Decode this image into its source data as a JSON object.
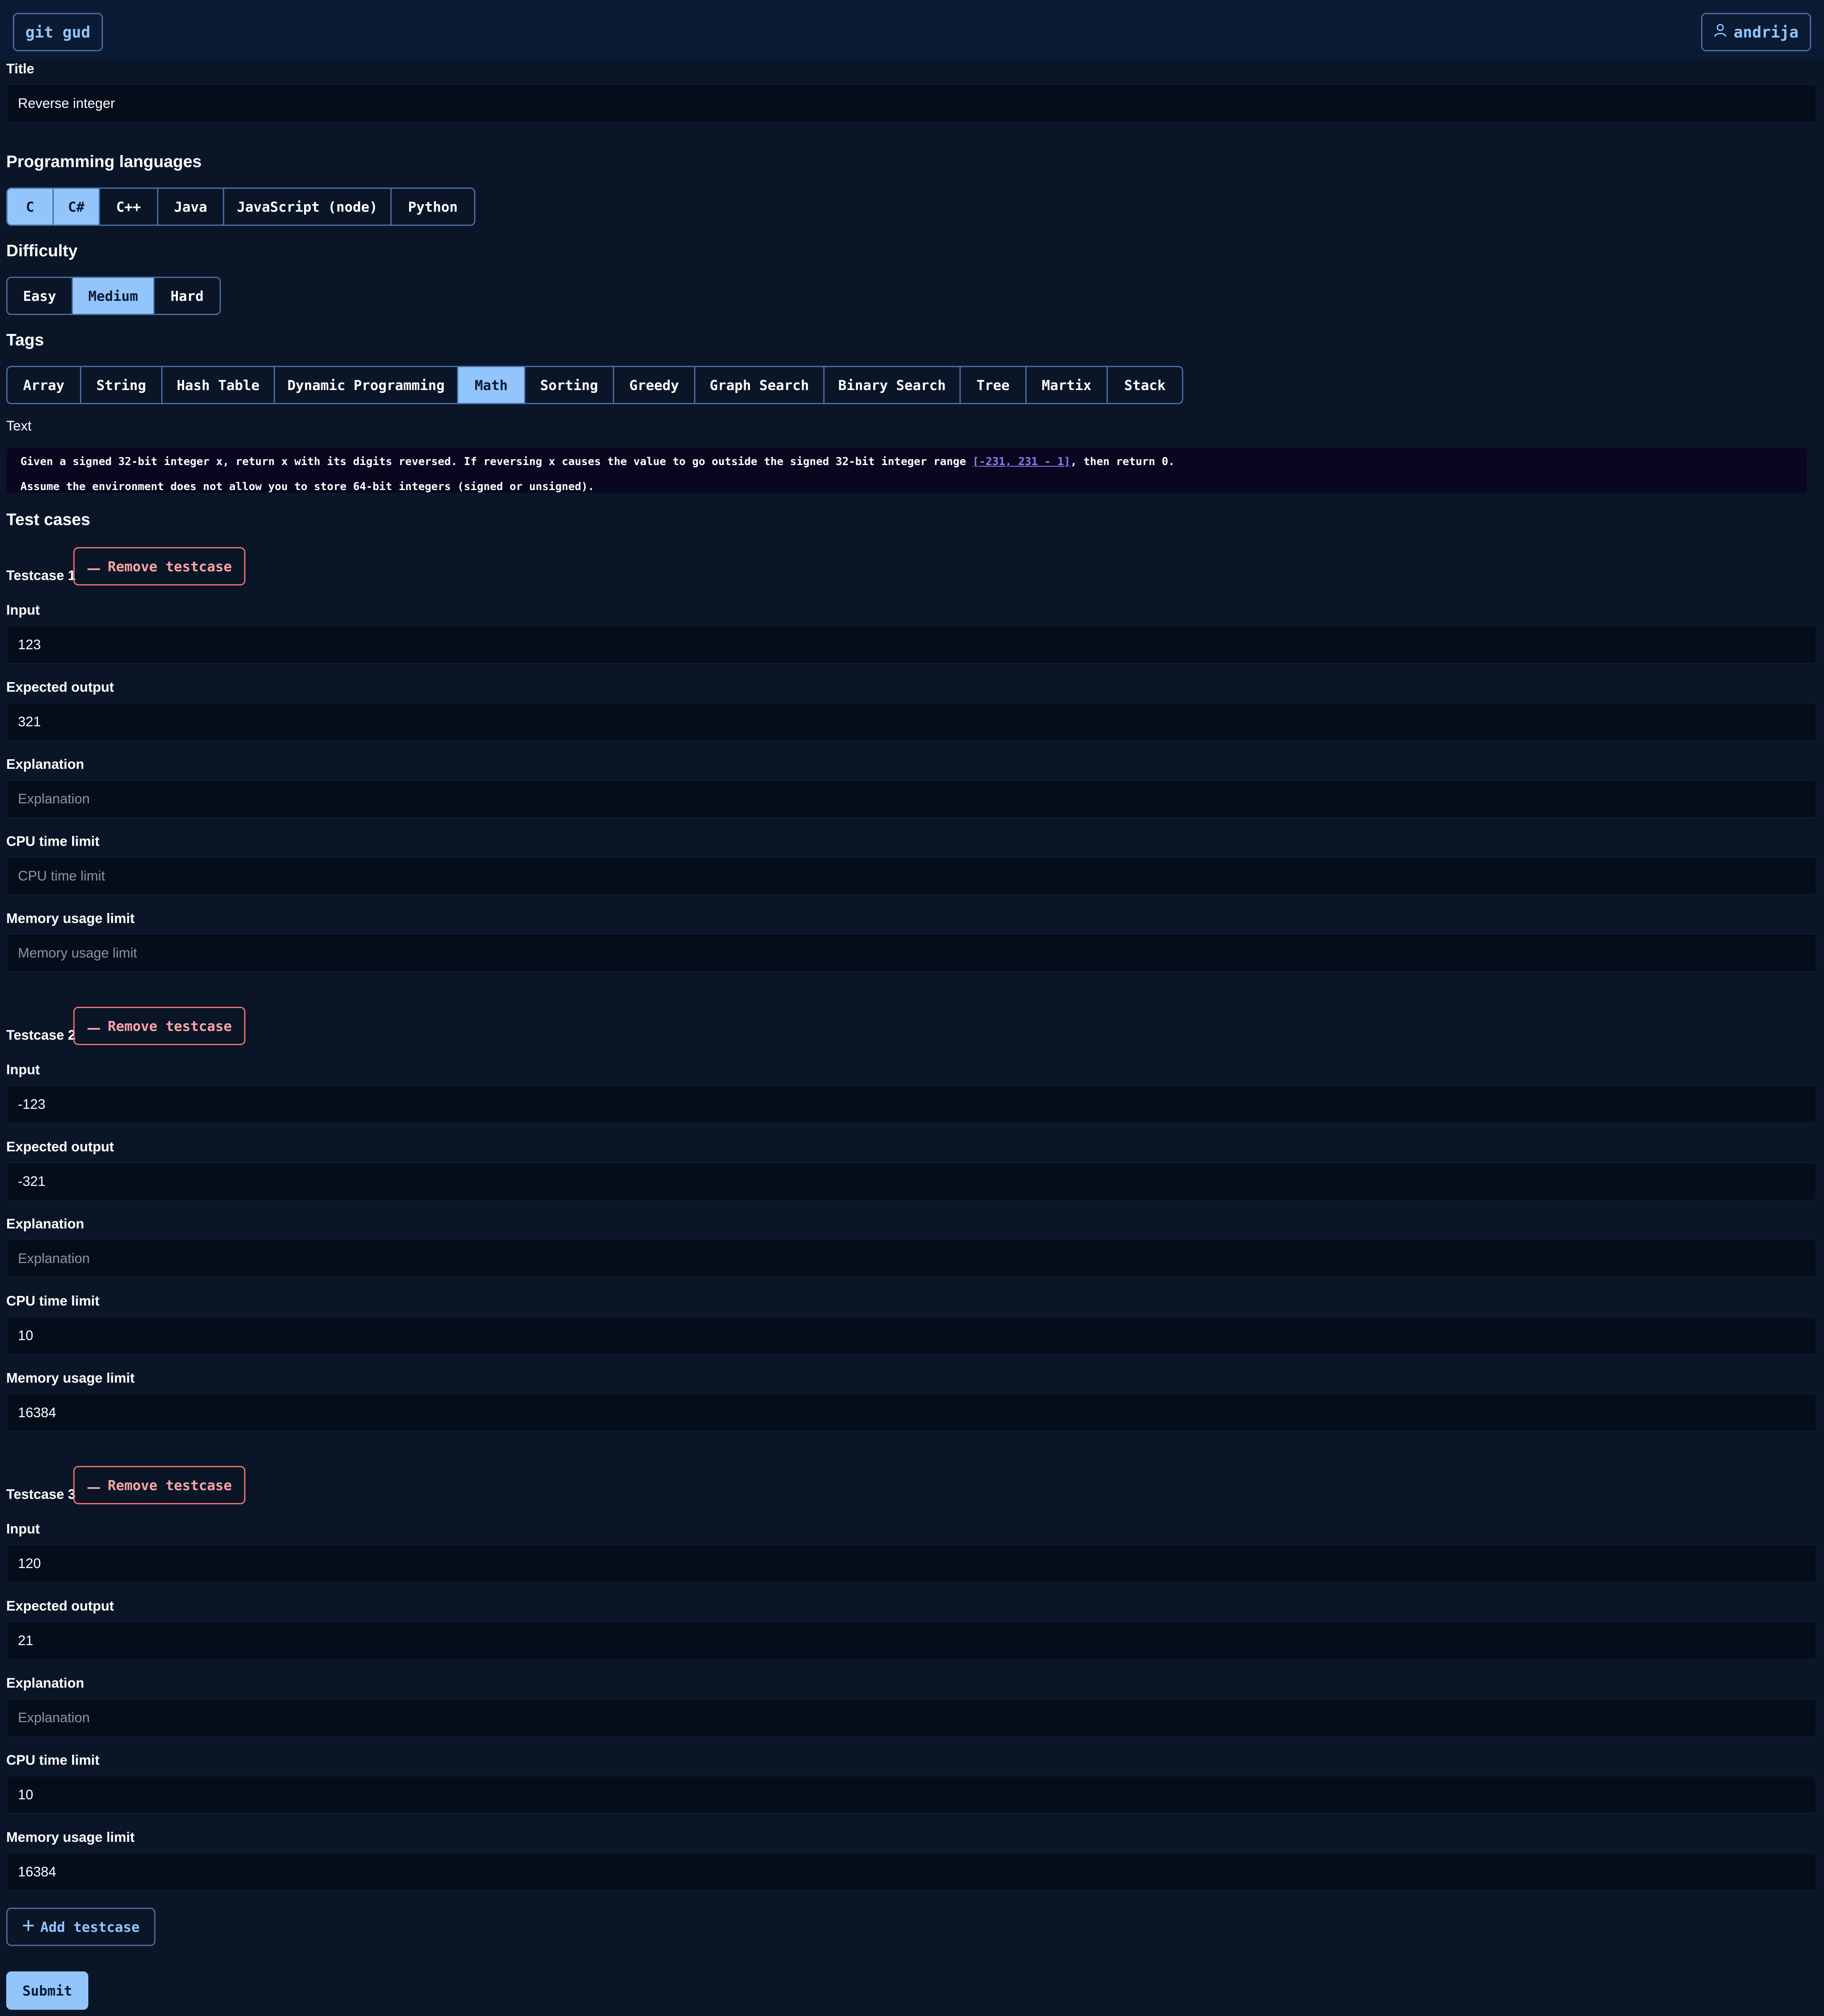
{
  "colors": {
    "background": "#0a1628",
    "navbar": "#0b1a33",
    "accent": "#93c5fd",
    "border": "#4a6fa5",
    "danger": "#f87171",
    "input_bg": "#050d1a",
    "text_area_bg": "#0a0620"
  },
  "navbar": {
    "brand": "git gud",
    "user": "andrija",
    "user_icon": "user-icon"
  },
  "form": {
    "title_label": "Title",
    "title_value": "Reverse integer",
    "languages_label": "Programming languages",
    "languages": [
      {
        "label": "C",
        "selected": true
      },
      {
        "label": "C#",
        "selected": true
      },
      {
        "label": "C++",
        "selected": false
      },
      {
        "label": "Java",
        "selected": false
      },
      {
        "label": "JavaScript (node)",
        "selected": false
      },
      {
        "label": "Python",
        "selected": false
      }
    ],
    "difficulty_label": "Difficulty",
    "difficulties": [
      {
        "label": "Easy",
        "selected": false
      },
      {
        "label": "Medium",
        "selected": true
      },
      {
        "label": "Hard",
        "selected": false
      }
    ],
    "tags_label": "Tags",
    "tags": [
      {
        "label": "Array",
        "selected": false
      },
      {
        "label": "String",
        "selected": false
      },
      {
        "label": "Hash Table",
        "selected": false
      },
      {
        "label": "Dynamic Programming",
        "selected": false
      },
      {
        "label": "Math",
        "selected": true
      },
      {
        "label": "Sorting",
        "selected": false
      },
      {
        "label": "Greedy",
        "selected": false
      },
      {
        "label": "Graph Search",
        "selected": false
      },
      {
        "label": "Binary Search",
        "selected": false
      },
      {
        "label": "Tree",
        "selected": false
      },
      {
        "label": "Martix",
        "selected": false
      },
      {
        "label": "Stack",
        "selected": false
      }
    ],
    "text_label": "Text",
    "text_line1_before": "Given a signed 32-bit integer x, return x with its digits reversed. If reversing x causes the value to go outside the signed 32-bit integer range ",
    "text_line1_range": "[-231, 231 - 1]",
    "text_line1_after": ", then return 0.",
    "text_line2": "Assume the environment does not allow you to store 64-bit integers (signed or unsigned).",
    "test_cases_label": "Test cases",
    "remove_label": "Remove testcase",
    "remove_icon": "minus-icon",
    "field_labels": {
      "input": "Input",
      "expected": "Expected output",
      "explanation": "Explanation",
      "cpu": "CPU time limit",
      "memory": "Memory usage limit"
    },
    "placeholders": {
      "explanation": "Explanation",
      "cpu": "CPU time limit",
      "memory": "Memory usage limit"
    },
    "testcases": [
      {
        "title": "Testcase 1",
        "input": "123",
        "expected": "321",
        "explanation": "",
        "cpu": "",
        "memory": ""
      },
      {
        "title": "Testcase 2",
        "input": "-123",
        "expected": "-321",
        "explanation": "",
        "cpu": "10",
        "memory": "16384"
      },
      {
        "title": "Testcase 3",
        "input": "120",
        "expected": "21",
        "explanation": "",
        "cpu": "10",
        "memory": "16384"
      }
    ],
    "add_testcase_label": "Add testcase",
    "add_icon": "plus-icon",
    "submit_label": "Submit"
  }
}
